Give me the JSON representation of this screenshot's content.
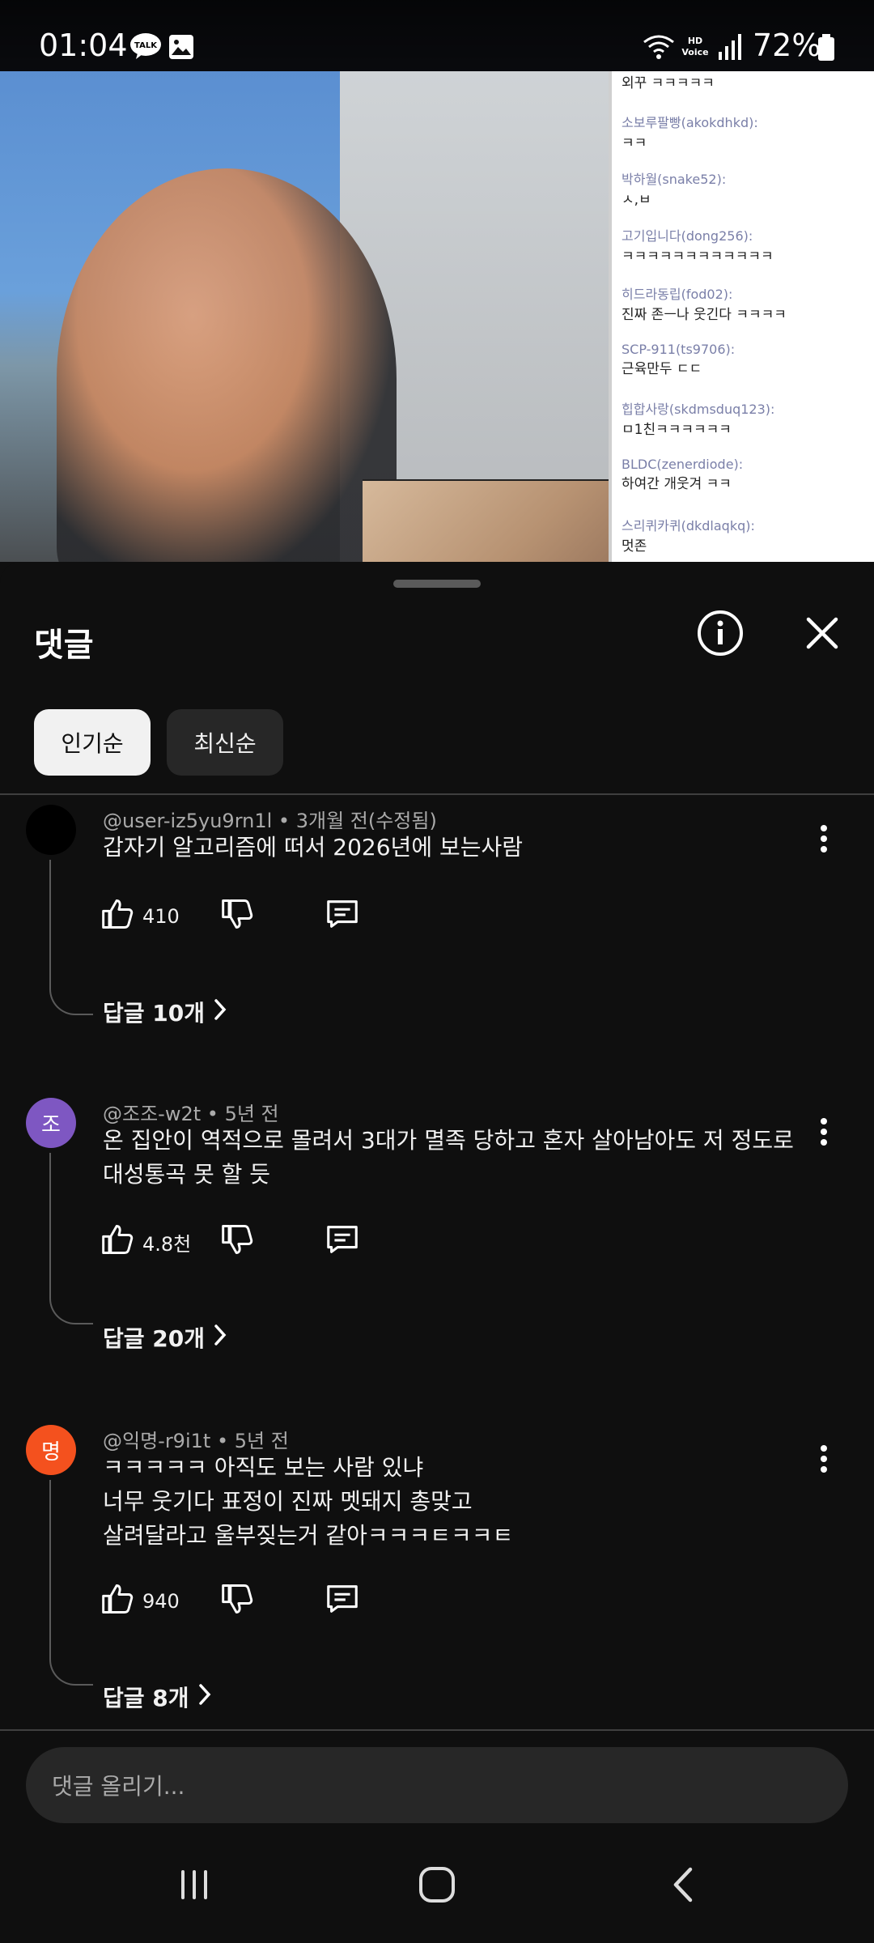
{
  "status_bar": {
    "time": "01:04",
    "battery": "72%",
    "notification_icons": [
      "talk-icon",
      "gallery-icon"
    ],
    "system_icons": [
      "wifi-icon",
      "hd-voice-icon",
      "signal-icon",
      "battery-icon"
    ],
    "hd_voice_label": "HD Voice",
    "talk_label": "TALK"
  },
  "video": {
    "chat_lines": [
      {
        "name": "",
        "message": "외꾸 ㅋㅋㅋㅋㅋ"
      },
      {
        "name": "소보루팔빵(akokdhkd):",
        "message": "ㅋㅋ"
      },
      {
        "name": "박하월(snake52):",
        "message": "ㅅ,ㅂ"
      },
      {
        "name": "고기입니다(dong256):",
        "message": "ㅋㅋㅋㅋㅋㅋㅋㅋㅋㅋㅋㅋ"
      },
      {
        "name": "히드라동립(fod02):",
        "message": "진짜 존ㅡ나 웃긴다 ㅋㅋㅋㅋ"
      },
      {
        "name": "SCP-911(ts9706):",
        "message": "근육만두 ㄷㄷ"
      },
      {
        "name": "힙합사랑(skdmsduq123):",
        "message": "ㅁ1친ㅋㅋㅋㅋㅋㅋ"
      },
      {
        "name": "BLDC(zenerdiode):",
        "message": "하여간 개웃겨 ㅋㅋ"
      },
      {
        "name": "스리퀴카퀴(dkdlaqkq):",
        "message": "멋존"
      }
    ]
  },
  "sheet": {
    "title": "댓글",
    "info_icon": "info-icon",
    "close_icon": "close-icon",
    "sort_chips": [
      {
        "label": "인기순",
        "active": true
      },
      {
        "label": "최신순",
        "active": false
      }
    ]
  },
  "comments": [
    {
      "author": "@user-iz5yu9rn1l",
      "time": "3개월 전(수정됨)",
      "text": "갑자기 알고리즘에 떠서 2026년에 보는사람",
      "likes": "410",
      "replies": "답글 10개",
      "avatar_letter": "",
      "avatar_color": "#000000"
    },
    {
      "author": "@조조-w2t",
      "time": "5년 전",
      "text": "온 집안이 역적으로 몰려서 3대가 멸족 당하고 혼자 살아남아도 저 정도로\n대성통곡 못 할 듯",
      "likes": "4.8천",
      "replies": "답글 20개",
      "avatar_letter": "조",
      "avatar_color": "#7e57c2"
    },
    {
      "author": "@익명-r9i1t",
      "time": "5년 전",
      "text": "ㅋㅋㅋㅋㅋ 아직도 보는 사람 있냐\n너무 웃기다 표정이 진짜 멧돼지 총맞고\n살려달라고 울부짖는거 같아ㅋㅋㅋㅌㅋㅋㅌ",
      "likes": "940",
      "replies": "답글 8개",
      "avatar_letter": "명",
      "avatar_color": "#f4511e"
    }
  ],
  "meta_separator": " • ",
  "composer": {
    "placeholder": "댓글 올리기..."
  },
  "navbar": {
    "buttons": [
      "recent-apps-icon",
      "home-icon",
      "back-icon"
    ]
  }
}
